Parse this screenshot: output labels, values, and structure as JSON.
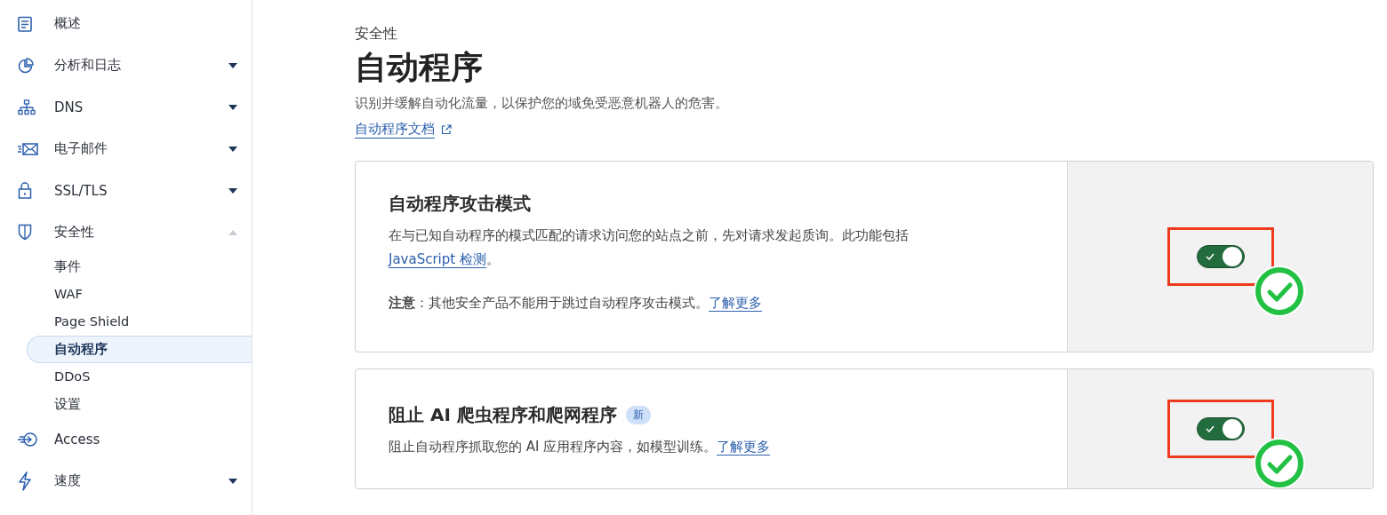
{
  "sidebar": {
    "items": [
      {
        "label": "概述"
      },
      {
        "label": "分析和日志",
        "expanded": false
      },
      {
        "label": "DNS",
        "expanded": false
      },
      {
        "label": "电子邮件",
        "expanded": false
      },
      {
        "label": "SSL/TLS",
        "expanded": false
      },
      {
        "label": "安全性",
        "expanded": true,
        "children": [
          {
            "label": "事件",
            "selected": false
          },
          {
            "label": "WAF",
            "selected": false
          },
          {
            "label": "Page Shield",
            "selected": false
          },
          {
            "label": "自动程序",
            "selected": true
          },
          {
            "label": "DDoS",
            "selected": false
          },
          {
            "label": "设置",
            "selected": false
          }
        ]
      },
      {
        "label": "Access"
      },
      {
        "label": "速度",
        "expanded": false
      }
    ]
  },
  "header": {
    "breadcrumb": "安全性",
    "title": "自动程序",
    "description": "识别并缓解自动化流量，以保护您的域免受恶意机器人的危害。",
    "doc_link": "自动程序文档"
  },
  "cards": [
    {
      "title": "自动程序攻击模式",
      "desc_before": "在与已知自动程序的模式匹配的请求访问您的站点之前，先对请求发起质询。此功能包括",
      "desc_link": "JavaScript 检测",
      "desc_after": "。",
      "note": "**注意**：其他安全产品不能用于跳过自动程序攻击模式。",
      "note_link": "了解更多",
      "on": true,
      "annotated": true
    },
    {
      "title": "阻止 AI 爬虫程序和爬网程序",
      "badge": "新",
      "desc_before": "阻止自动程序抓取您的 AI 应用程序内容，如模型训练。",
      "desc_link": "了解更多",
      "on": true,
      "annotated": true
    }
  ]
}
